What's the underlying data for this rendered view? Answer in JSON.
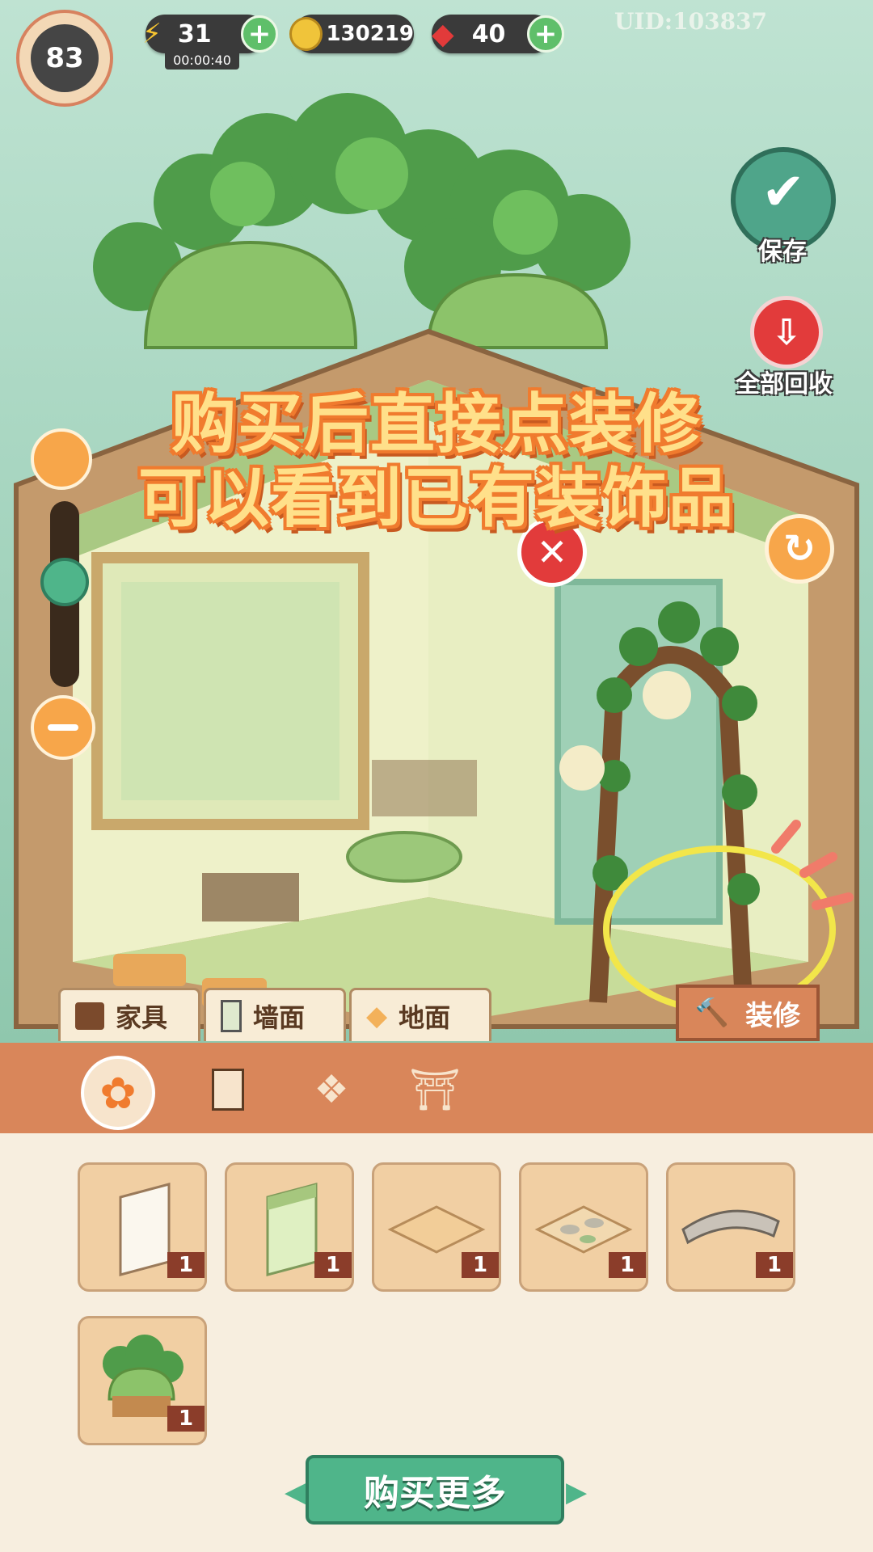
{
  "hud": {
    "level": "83",
    "energy": "31",
    "energy_timer": "00:00:40",
    "coins": "130219",
    "gems": "40",
    "uid": "UID:103837"
  },
  "right_buttons": {
    "save_label": "保存",
    "recycle_all_label": "全部回收"
  },
  "overlay": {
    "line1": "购买后直接点装修",
    "line2": "可以看到已有装饰品"
  },
  "decorate_button": "装修",
  "category_tabs": [
    {
      "label": "家具"
    },
    {
      "label": "墙面"
    },
    {
      "label": "地面"
    }
  ],
  "sub_tabs": [
    "all-icon",
    "wall-icon",
    "floor-icon",
    "roof-icon"
  ],
  "inventory": [
    {
      "name": "white-wall",
      "count": "1"
    },
    {
      "name": "green-wall",
      "count": "1"
    },
    {
      "name": "wood-floor",
      "count": "1"
    },
    {
      "name": "stone-floor",
      "count": "1"
    },
    {
      "name": "tile-roof",
      "count": "1"
    },
    {
      "name": "garden-house",
      "count": "1"
    }
  ],
  "buy_more": "购买更多",
  "colors": {
    "accent_green": "#4fb58a",
    "tab_orange": "#d9865a",
    "highlight_yellow": "#f2e64a"
  }
}
